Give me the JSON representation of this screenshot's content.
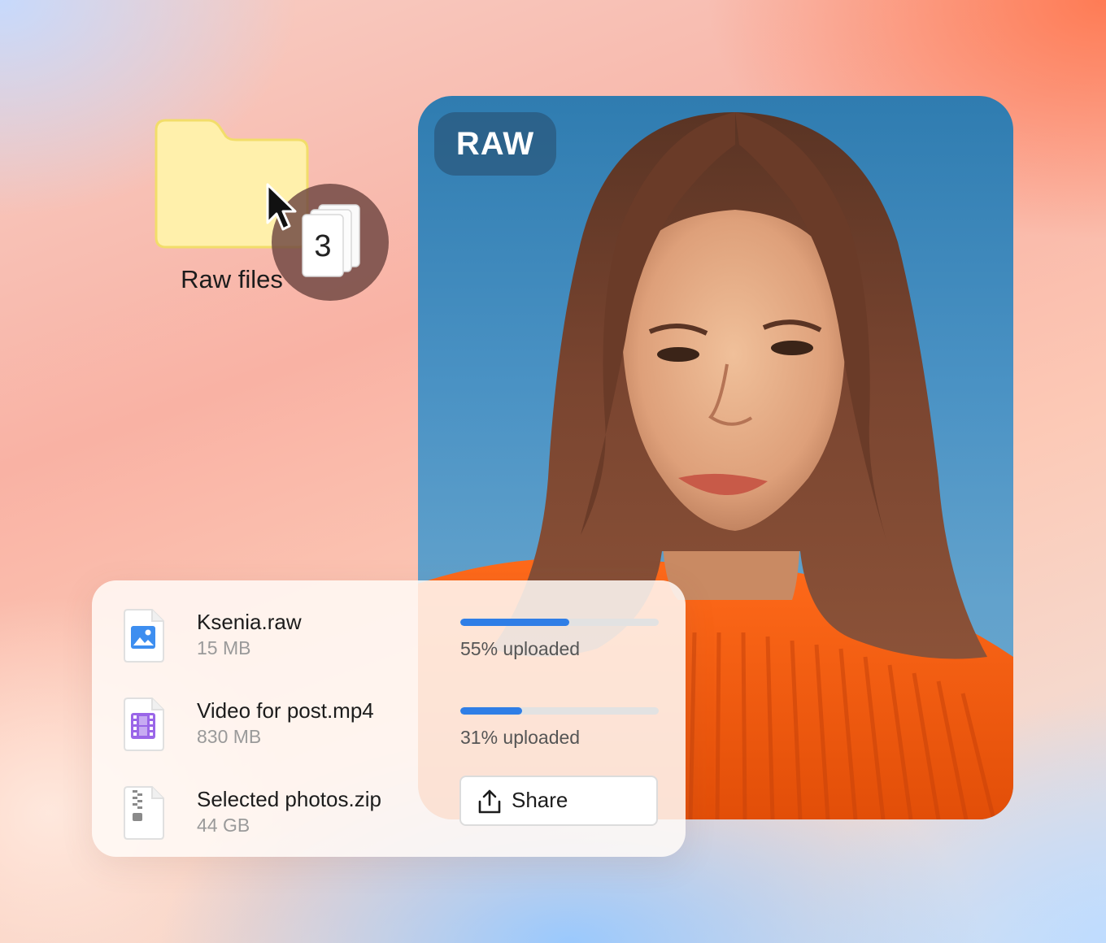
{
  "folder": {
    "label": "Raw files",
    "drag_count": "3"
  },
  "photo": {
    "badge": "RAW"
  },
  "uploads": [
    {
      "name": "Ksenia.raw",
      "size": "15 MB",
      "icon": "image-file-icon",
      "progress": 0.55,
      "status": "55% uploaded"
    },
    {
      "name": "Video for post.mp4",
      "size": "830 MB",
      "icon": "video-file-icon",
      "progress": 0.31,
      "status": "31% uploaded"
    },
    {
      "name": "Selected photos.zip",
      "size": "44 GB",
      "icon": "zip-file-icon"
    }
  ],
  "share": {
    "label": "Share",
    "icon": "share-icon"
  },
  "colors": {
    "progress": "#2f7ee6",
    "folder": "#fff0ab",
    "folder_border": "#f2dd6a",
    "image_icon": "#3d8ef0",
    "video_icon": "#9a66e8"
  }
}
